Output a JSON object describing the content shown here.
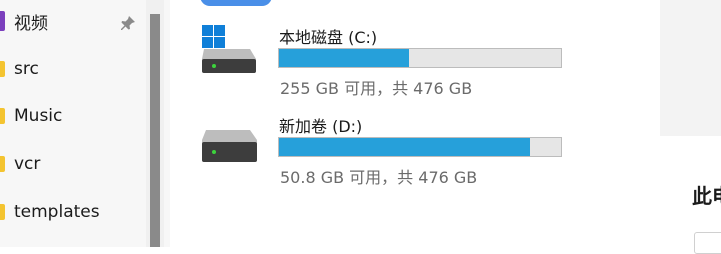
{
  "sidebar": {
    "items": [
      {
        "label": "视频",
        "icon": "video-folder-icon",
        "pinned": true
      },
      {
        "label": "src",
        "icon": "folder-icon"
      },
      {
        "label": "Music",
        "icon": "folder-icon"
      },
      {
        "label": "vcr",
        "icon": "folder-icon"
      },
      {
        "label": "templates",
        "icon": "folder-icon"
      }
    ]
  },
  "drives": [
    {
      "name": "本地磁盘 (C:)",
      "meta": "255 GB 可用，共 476 GB",
      "used_fraction": 0.46,
      "icon": "windows-drive-icon"
    },
    {
      "name": "新加卷 (D:)",
      "meta": "50.8 GB 可用，共 476 GB",
      "used_fraction": 0.89,
      "icon": "drive-icon"
    }
  ],
  "right_pane": {
    "heading": "此电"
  },
  "colors": {
    "accent": "#26a0da",
    "tab": "#4a8fe8",
    "folder": "#f4c430",
    "video_folder": "#7b3fbd"
  }
}
